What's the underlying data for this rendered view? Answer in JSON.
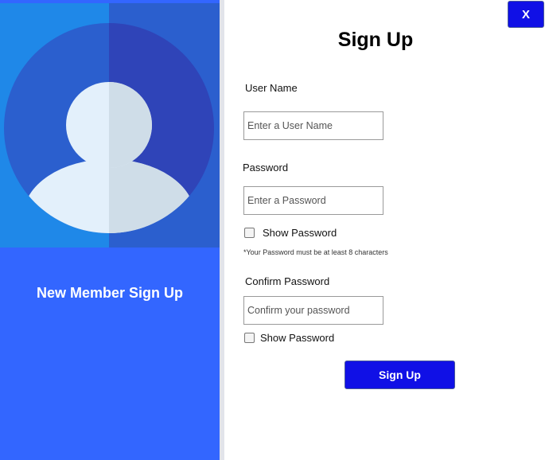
{
  "window": {
    "close_label": "X"
  },
  "left_panel": {
    "title": "New Member Sign Up",
    "avatar_icon": "user-avatar-icon"
  },
  "form": {
    "title": "Sign Up",
    "username": {
      "label": "User Name",
      "placeholder": "Enter a User Name",
      "value": ""
    },
    "password": {
      "label": "Password",
      "placeholder": "Enter a Password",
      "value": "",
      "show_password_label": "Show Password",
      "show_password_checked": false,
      "hint": "*Your Password must be at least 8 characters"
    },
    "confirm_password": {
      "label": "Confirm Password",
      "placeholder": "Confirm your password",
      "value": "",
      "show_password_label": "Show Password",
      "show_password_checked": false
    },
    "submit_label": "Sign Up"
  },
  "colors": {
    "panel_blue": "#3366ff",
    "button_blue": "#1010e6"
  }
}
